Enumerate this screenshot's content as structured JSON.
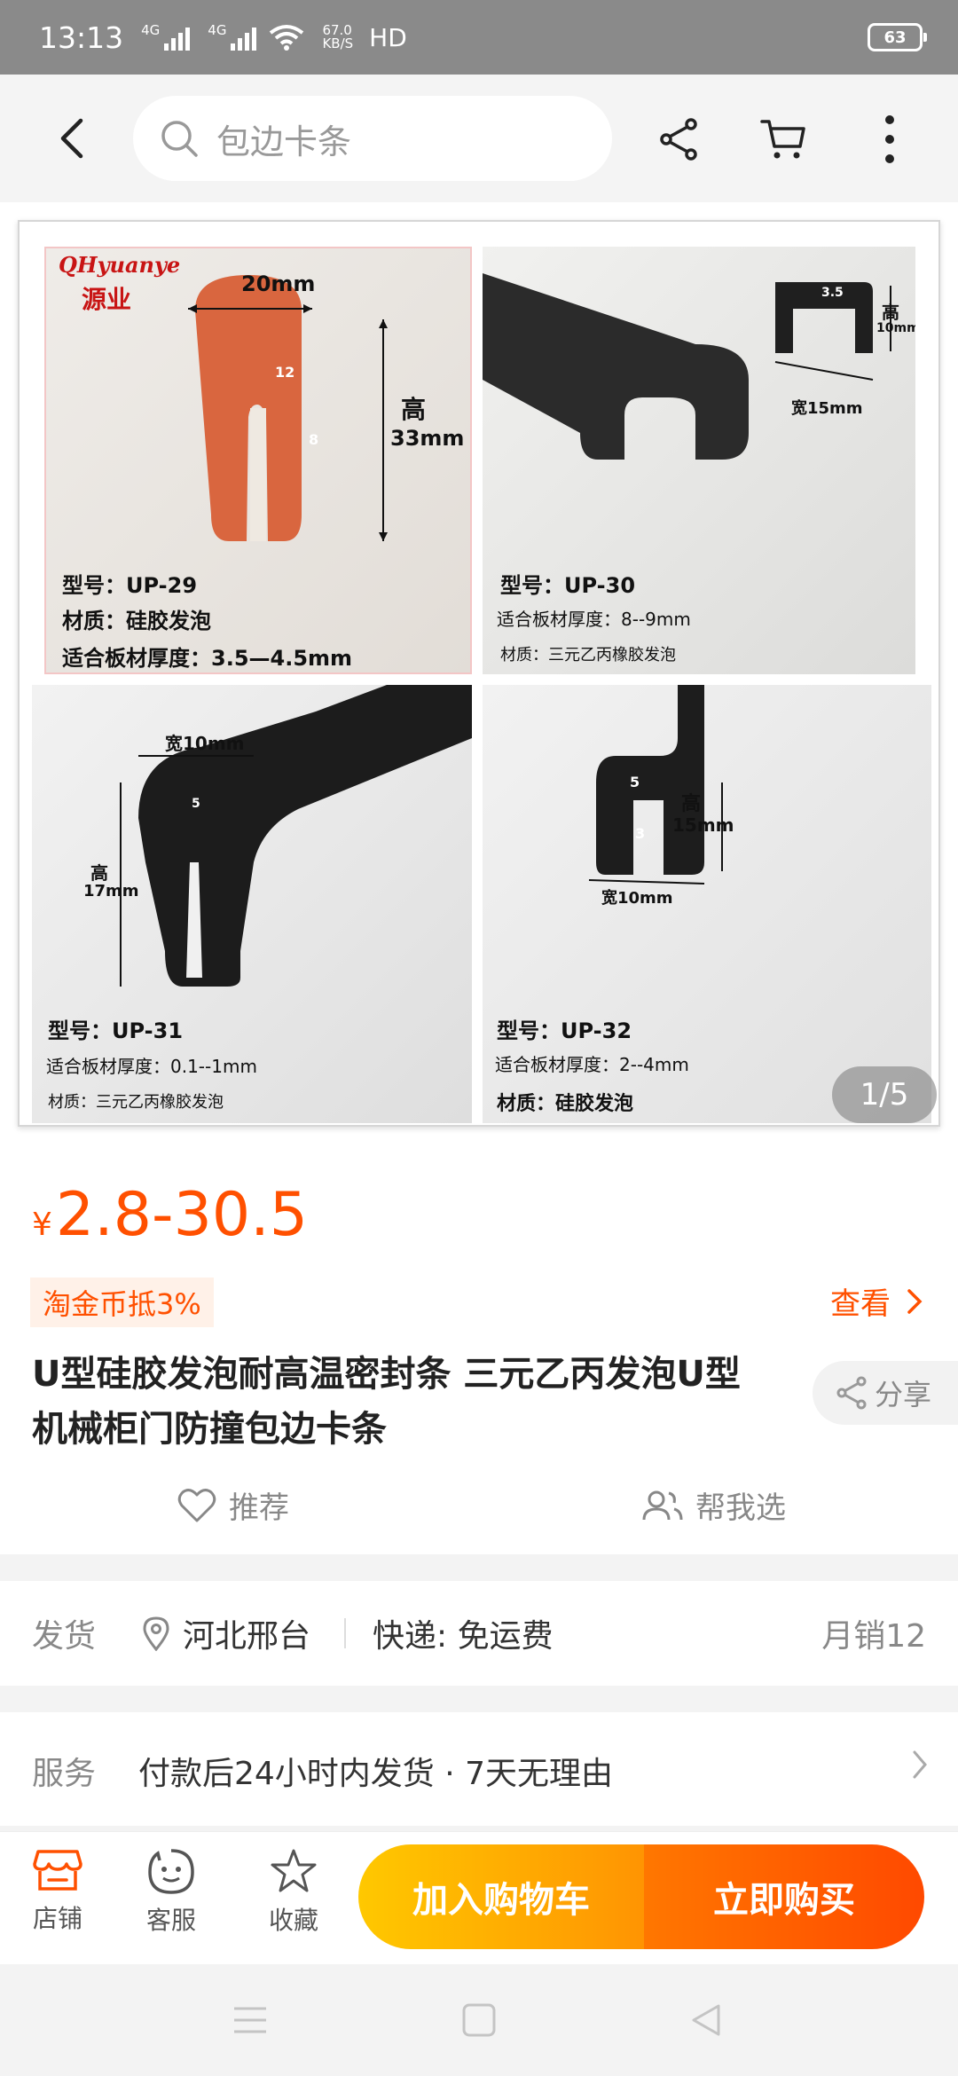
{
  "status_bar": {
    "time": "13:13",
    "net1": "4G",
    "net2": "4G",
    "speed_value": "67.0",
    "speed_unit": "KB/S",
    "hd": "HD",
    "battery": "63"
  },
  "top_nav": {
    "search_placeholder": "包边卡条"
  },
  "gallery": {
    "page_indicator": "1/5",
    "images": [
      {
        "brand_en": "QHyuanye",
        "brand_cn": "源业",
        "dim_width": "20mm",
        "dim_height_label": "高",
        "dim_height": "33mm",
        "dim_inner1": "12",
        "dim_inner2": "8",
        "model": "型号：UP-29",
        "material": "材质：硅胶发泡",
        "thickness": "适合板材厚度：3.5—4.5mm"
      },
      {
        "dim_inner": "3.5",
        "dim_height_label": "高",
        "dim_height": "10mm",
        "dim_width": "宽15mm",
        "model": "型号：UP-30",
        "thickness": "适合板材厚度：8--9mm",
        "material": "材质：三元乙丙橡胶发泡"
      },
      {
        "dim_width": "宽10mm",
        "dim_inner": "5",
        "dim_height_label": "高",
        "dim_height": "17mm",
        "model": "型号：UP-31",
        "thickness": "适合板材厚度：0.1--1mm",
        "material": "材质：三元乙丙橡胶发泡"
      },
      {
        "dim_inner1": "5",
        "dim_inner2": "3",
        "dim_height_label": "高",
        "dim_height": "15mm",
        "dim_width": "宽10mm",
        "model": "型号：UP-32",
        "thickness": "适合板材厚度：2--4mm",
        "material": "材质：硅胶发泡"
      }
    ]
  },
  "product": {
    "currency": "¥",
    "price": "2.8-30.5",
    "coupon": "淘金币抵3%",
    "view_label": "查看",
    "title_line1": "U型硅胶发泡耐高温密封条 三元乙丙发泡U型",
    "title_line2": "机械柜门防撞包边卡条",
    "share_label": "分享",
    "recommend_label": "推荐",
    "help_choose_label": "帮我选"
  },
  "shipping": {
    "label": "发货",
    "location": "河北邢台",
    "express": "快递: 免运费",
    "monthly_sales": "月销12"
  },
  "service": {
    "label": "服务",
    "text": "付款后24小时内发货 · 7天无理由"
  },
  "bottom_bar": {
    "store_label": "店铺",
    "service_label": "客服",
    "favorite_label": "收藏",
    "add_cart_label": "加入购物车",
    "buy_now_label": "立即购买"
  },
  "colors": {
    "accent": "#ff5000",
    "cart_gradient": [
      "#ffc800",
      "#ff9402"
    ],
    "buy_gradient": [
      "#ff7700",
      "#ff4900"
    ]
  },
  "icons": [
    "back-arrow-icon",
    "search-icon",
    "share-icon",
    "cart-icon",
    "more-vertical-icon",
    "chevron-right-icon",
    "heart-icon",
    "people-icon",
    "location-pin-icon",
    "store-icon",
    "customer-service-icon",
    "star-icon",
    "menu-icon",
    "home-square-icon",
    "back-triangle-icon"
  ]
}
